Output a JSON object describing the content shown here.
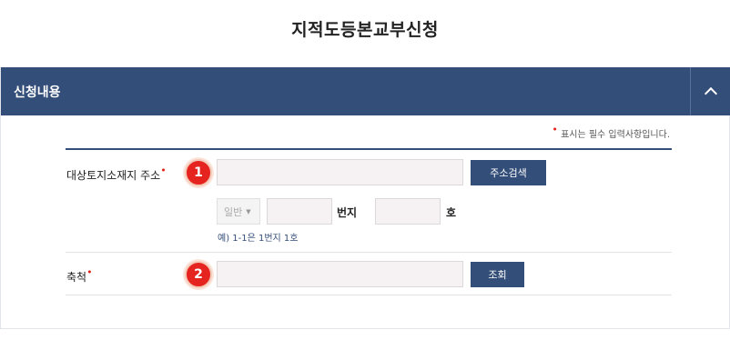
{
  "page": {
    "title": "지적도등본교부신청"
  },
  "panel": {
    "title": "신청내용",
    "toggle_icon": "chevron-up-icon"
  },
  "required_note": "표시는 필수 입력사항입니다.",
  "fields": {
    "address": {
      "label": "대상토지소재지 주소",
      "marker": "1",
      "search_button": "주소검색",
      "lot_type": "일반",
      "lot_main_suffix": "번지",
      "lot_sub_suffix": "호",
      "hint": "예) 1-1은 1번지 1호"
    },
    "scale": {
      "label": "축척",
      "marker": "2",
      "lookup_button": "조회"
    }
  },
  "colors": {
    "primary": "#334e78",
    "required": "#e0261f",
    "marker": "#e52420"
  }
}
